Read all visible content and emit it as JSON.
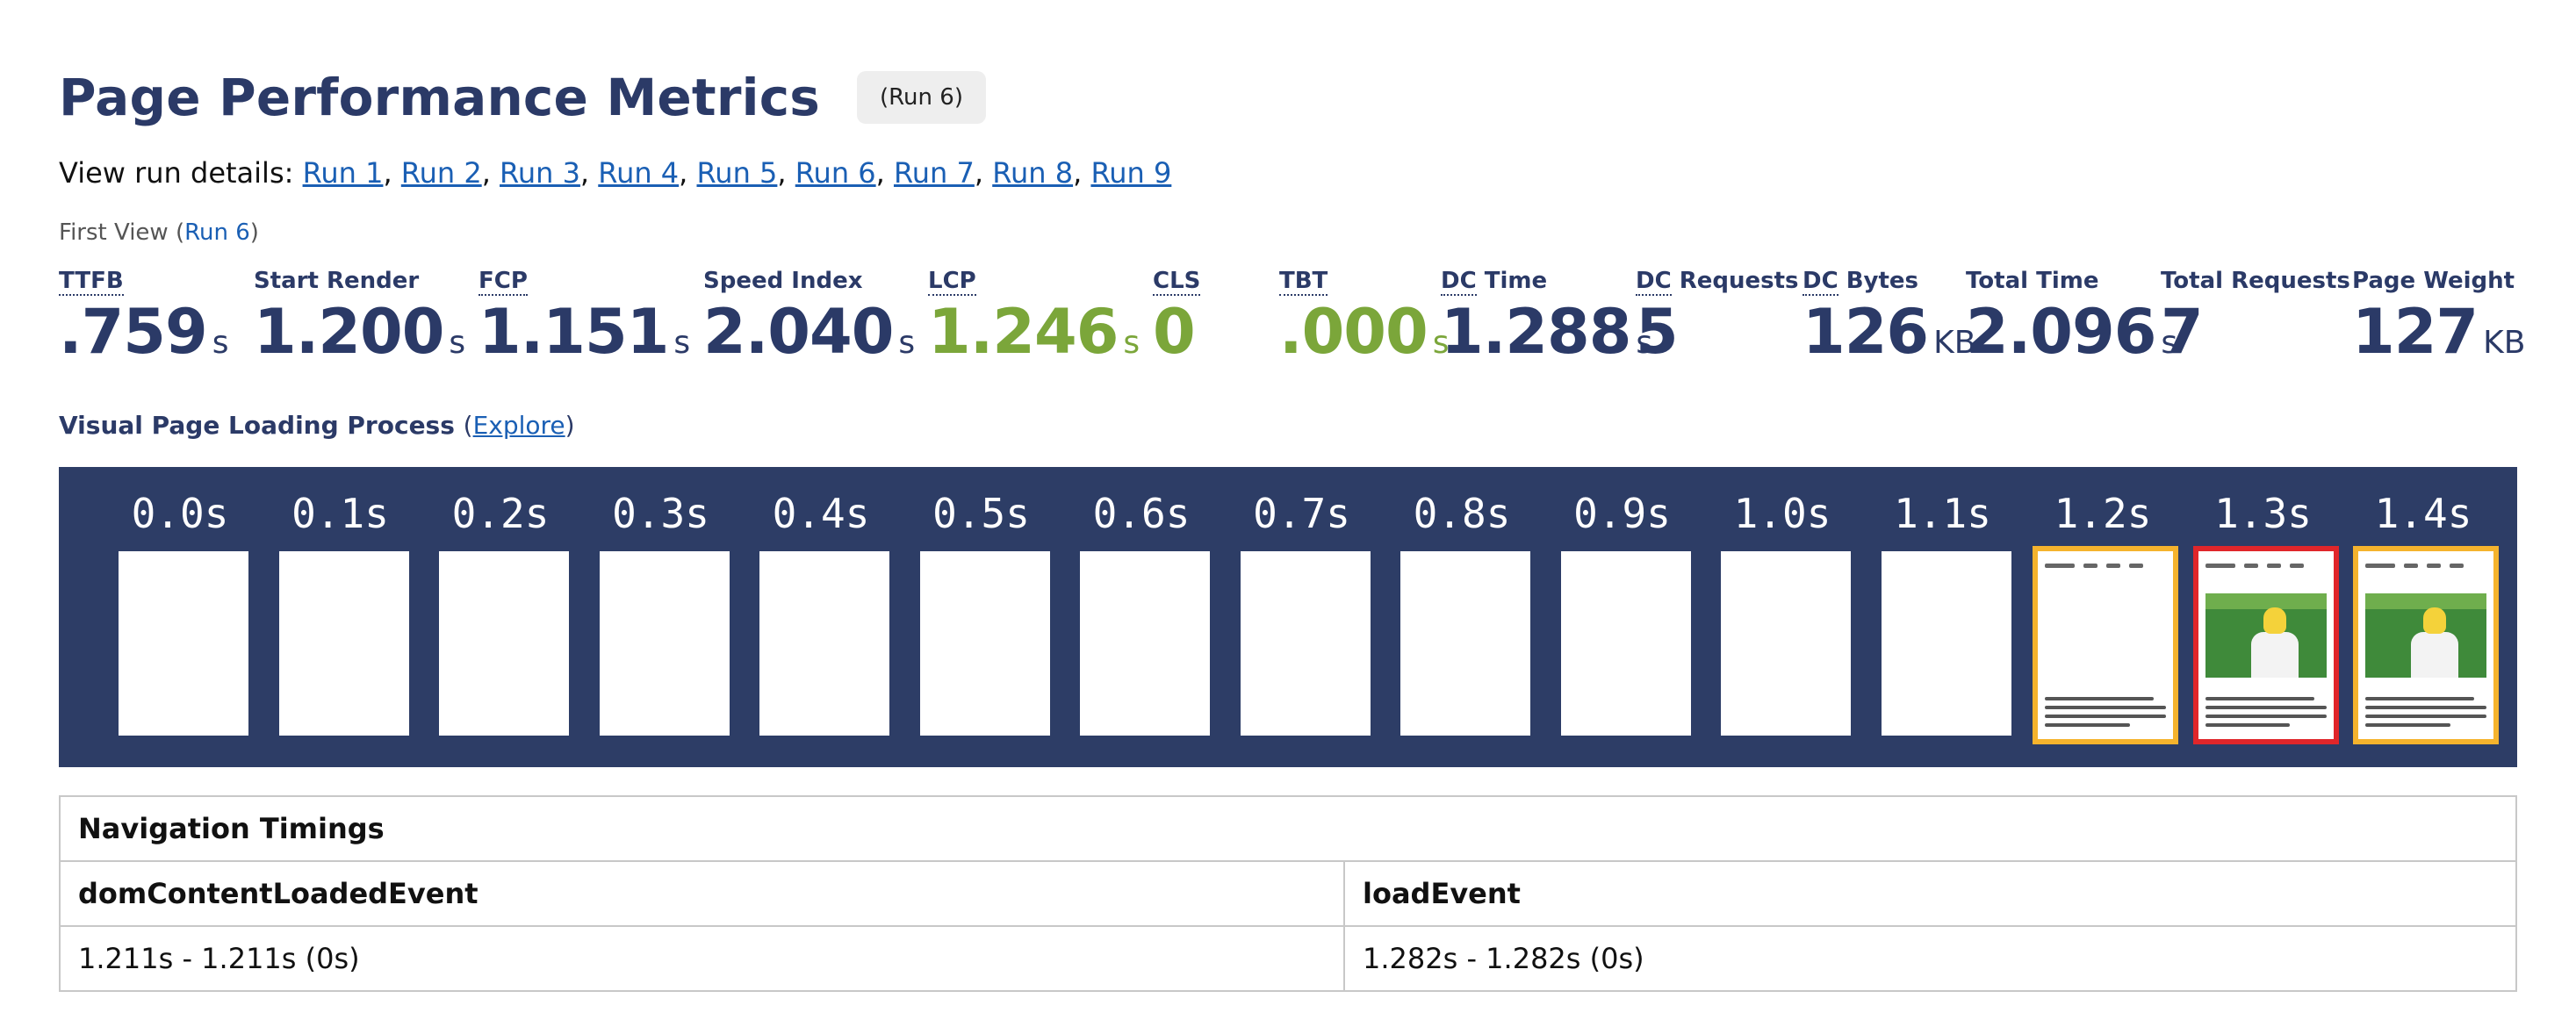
{
  "header": {
    "title": "Page Performance Metrics",
    "run_badge": "(Run 6)"
  },
  "run_details": {
    "prefix": "View run details:",
    "runs": [
      "Run 1",
      "Run 2",
      "Run 3",
      "Run 4",
      "Run 5",
      "Run 6",
      "Run 7",
      "Run 8",
      "Run 9"
    ]
  },
  "first_view": {
    "prefix": "First View (",
    "run_link": "Run 6",
    "suffix": ")"
  },
  "metrics": [
    {
      "label": "TTFB",
      "value": ".759",
      "unit": "s",
      "status": "normal"
    },
    {
      "label": "Start Render",
      "value": "1.200",
      "unit": "s",
      "status": "normal"
    },
    {
      "label": "FCP",
      "value": "1.151",
      "unit": "s",
      "status": "normal"
    },
    {
      "label": "Speed Index",
      "value": "2.040",
      "unit": "s",
      "status": "normal"
    },
    {
      "label": "LCP",
      "value": "1.246",
      "unit": "s",
      "status": "good"
    },
    {
      "label": "CLS",
      "value": "0",
      "unit": "",
      "status": "good"
    },
    {
      "label": "TBT",
      "value": ".000",
      "unit": "s",
      "status": "good"
    },
    {
      "label_abbr": "DC",
      "label_rest": " Time",
      "value": "1.288",
      "unit": "s",
      "status": "normal"
    },
    {
      "label_abbr": "DC",
      "label_rest": " Requests",
      "value": "5",
      "unit": "",
      "status": "normal"
    },
    {
      "label_abbr": "DC",
      "label_rest": " Bytes",
      "value": "126",
      "unit": "KB",
      "status": "normal"
    },
    {
      "label": "Total Time",
      "value": "2.096",
      "unit": "s",
      "status": "normal"
    },
    {
      "label": "Total Requests",
      "value": "7",
      "unit": "",
      "status": "normal"
    },
    {
      "label": "Page Weight",
      "value": "127",
      "unit": "KB",
      "status": "normal"
    }
  ],
  "visual": {
    "heading": "Visual Page Loading Process",
    "open_paren": "(",
    "explore_link": "Explore",
    "close_paren": ")"
  },
  "filmstrip": {
    "frames": [
      {
        "time": "0.0s",
        "state": "blank"
      },
      {
        "time": "0.1s",
        "state": "blank"
      },
      {
        "time": "0.2s",
        "state": "blank"
      },
      {
        "time": "0.3s",
        "state": "blank"
      },
      {
        "time": "0.4s",
        "state": "blank"
      },
      {
        "time": "0.5s",
        "state": "blank"
      },
      {
        "time": "0.6s",
        "state": "blank"
      },
      {
        "time": "0.7s",
        "state": "blank"
      },
      {
        "time": "0.8s",
        "state": "blank"
      },
      {
        "time": "0.9s",
        "state": "blank"
      },
      {
        "time": "1.0s",
        "state": "blank"
      },
      {
        "time": "1.1s",
        "state": "blank"
      },
      {
        "time": "1.2s",
        "state": "text-only",
        "border": "yellow"
      },
      {
        "time": "1.3s",
        "state": "full",
        "border": "red"
      },
      {
        "time": "1.4s",
        "state": "full",
        "border": "yellow"
      }
    ],
    "colors": {
      "background": "#2d3d66",
      "changed": "#f5b32d",
      "lcp": "#e0262a"
    }
  },
  "navigation_timings": {
    "title": "Navigation Timings",
    "columns": [
      "domContentLoadedEvent",
      "loadEvent"
    ],
    "values": [
      "1.211s - 1.211s (0s)",
      "1.282s - 1.282s (0s)"
    ]
  },
  "colors": {
    "heading": "#2b3a67",
    "good": "#7ba63a",
    "link": "#1a5fb4"
  }
}
